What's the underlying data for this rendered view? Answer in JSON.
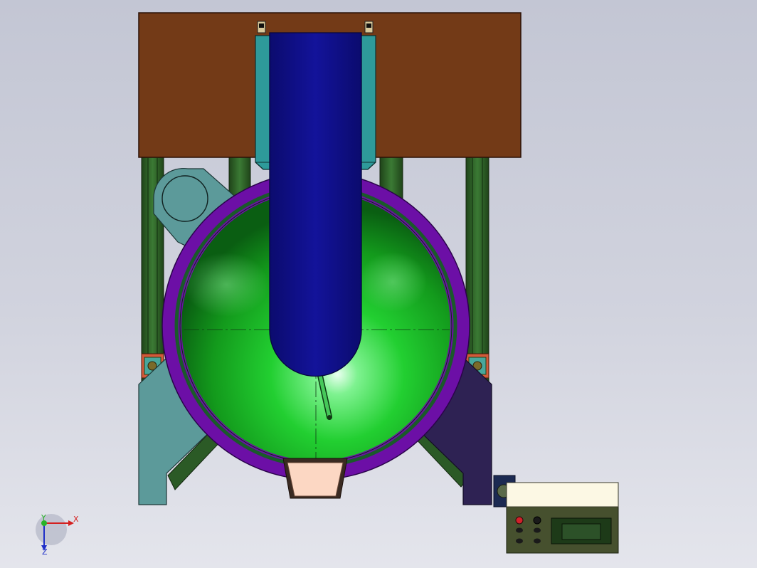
{
  "triad": {
    "x_label": "X",
    "y_label": "Y",
    "z_label": "Z"
  },
  "colors": {
    "frame_plate": "#733a17",
    "frame_column": "#2b5a26",
    "bracket_left": "#5c9a9a",
    "bracket_right": "#2e2253",
    "bowl_rim": "#6c0fa6",
    "bowl_interior": "#1fd128",
    "arm": "#12128a",
    "guide_block": "#2e9a9a",
    "spout": "#fcd7c3",
    "control_box": "#46502e",
    "control_lid": "#fcf8e4",
    "display_screen": "#2c5128"
  }
}
